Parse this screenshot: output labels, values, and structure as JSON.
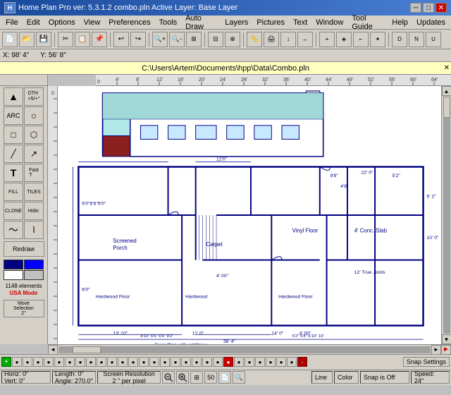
{
  "titlebar": {
    "icon": "H",
    "title": "Home Plan Pro ver: 5.3.1.2  combo.pln    Active Layer: Base Layer",
    "minimize": "─",
    "maximize": "□",
    "close": "✕"
  },
  "menu": {
    "items": [
      "File",
      "Edit",
      "Options",
      "View",
      "Preferences",
      "Tools",
      "Auto Draw",
      "Layers",
      "Pictures",
      "Text",
      "Window",
      "Tool Guide",
      "Help",
      "Updates"
    ]
  },
  "toolbar": {
    "buttons": [
      "📁",
      "💾",
      "📋",
      "✂",
      "📄",
      "↩",
      "↪",
      "🔍",
      "🔎",
      "⬛",
      "⬜",
      "📏",
      "📐",
      "✏",
      "📌",
      "🔧",
      "⚙",
      "💡",
      "🖨",
      "📊"
    ]
  },
  "coords": {
    "x_label": "X: 98' 4\"",
    "y_label": "Y: 56' 8\""
  },
  "filepath": {
    "path": "C:\\Users\\Artem\\Documents\\hpp\\Data\\Combo.pln"
  },
  "left_toolbar": {
    "tools": [
      {
        "name": "select",
        "label": "▲"
      },
      {
        "name": "dth",
        "label": "DTH\n+5/+°"
      },
      {
        "name": "arc",
        "label": "ARC"
      },
      {
        "name": "rect",
        "label": "□"
      },
      {
        "name": "wall",
        "label": "⊓"
      },
      {
        "name": "door",
        "label": "↗"
      },
      {
        "name": "text",
        "label": "T"
      },
      {
        "name": "fast-text",
        "label": "Fast T"
      },
      {
        "name": "fill",
        "label": "FILL"
      },
      {
        "name": "tiles",
        "label": "TILES"
      },
      {
        "name": "clone",
        "label": "CLONE"
      },
      {
        "name": "hide",
        "label": "Hide"
      },
      {
        "name": "curve",
        "label": "~"
      },
      {
        "name": "pipe",
        "label": "⌇"
      },
      {
        "name": "redraw",
        "label": "Redraw"
      },
      {
        "name": "color1",
        "color": "#000080"
      },
      {
        "name": "color2",
        "color": "#0000ff"
      },
      {
        "name": "color3",
        "color": "#ffffff"
      },
      {
        "name": "color4",
        "color": "#c0c0c0"
      },
      {
        "name": "elements",
        "label": "1148 elements"
      },
      {
        "name": "mode",
        "label": "USA Mode"
      },
      {
        "name": "move-sel",
        "label": "Move\nSelection\n2\""
      }
    ]
  },
  "status_bar": {
    "top_buttons": [
      "+",
      "●",
      "●",
      "●",
      "●",
      "●",
      "●",
      "●",
      "●",
      "●",
      "●",
      "●",
      "●",
      "●",
      "●",
      "●",
      "●",
      "●",
      "●",
      "●",
      "●",
      "-"
    ],
    "horiz": "Horiz: 0\"",
    "vert": "Vert: 0\"",
    "length": "Length: 0\"",
    "angle": "Angle: 270.0°",
    "resolution": "Screen Resolution\n2 \" per pixel",
    "zoom_out": "🔍-",
    "zoom_in": "🔍+",
    "line": "Line",
    "color": "Color",
    "snap_settings": "Snap Settings",
    "snap_status": "Snap is Off",
    "speed_label": "Speed:",
    "speed_value": "24\""
  }
}
